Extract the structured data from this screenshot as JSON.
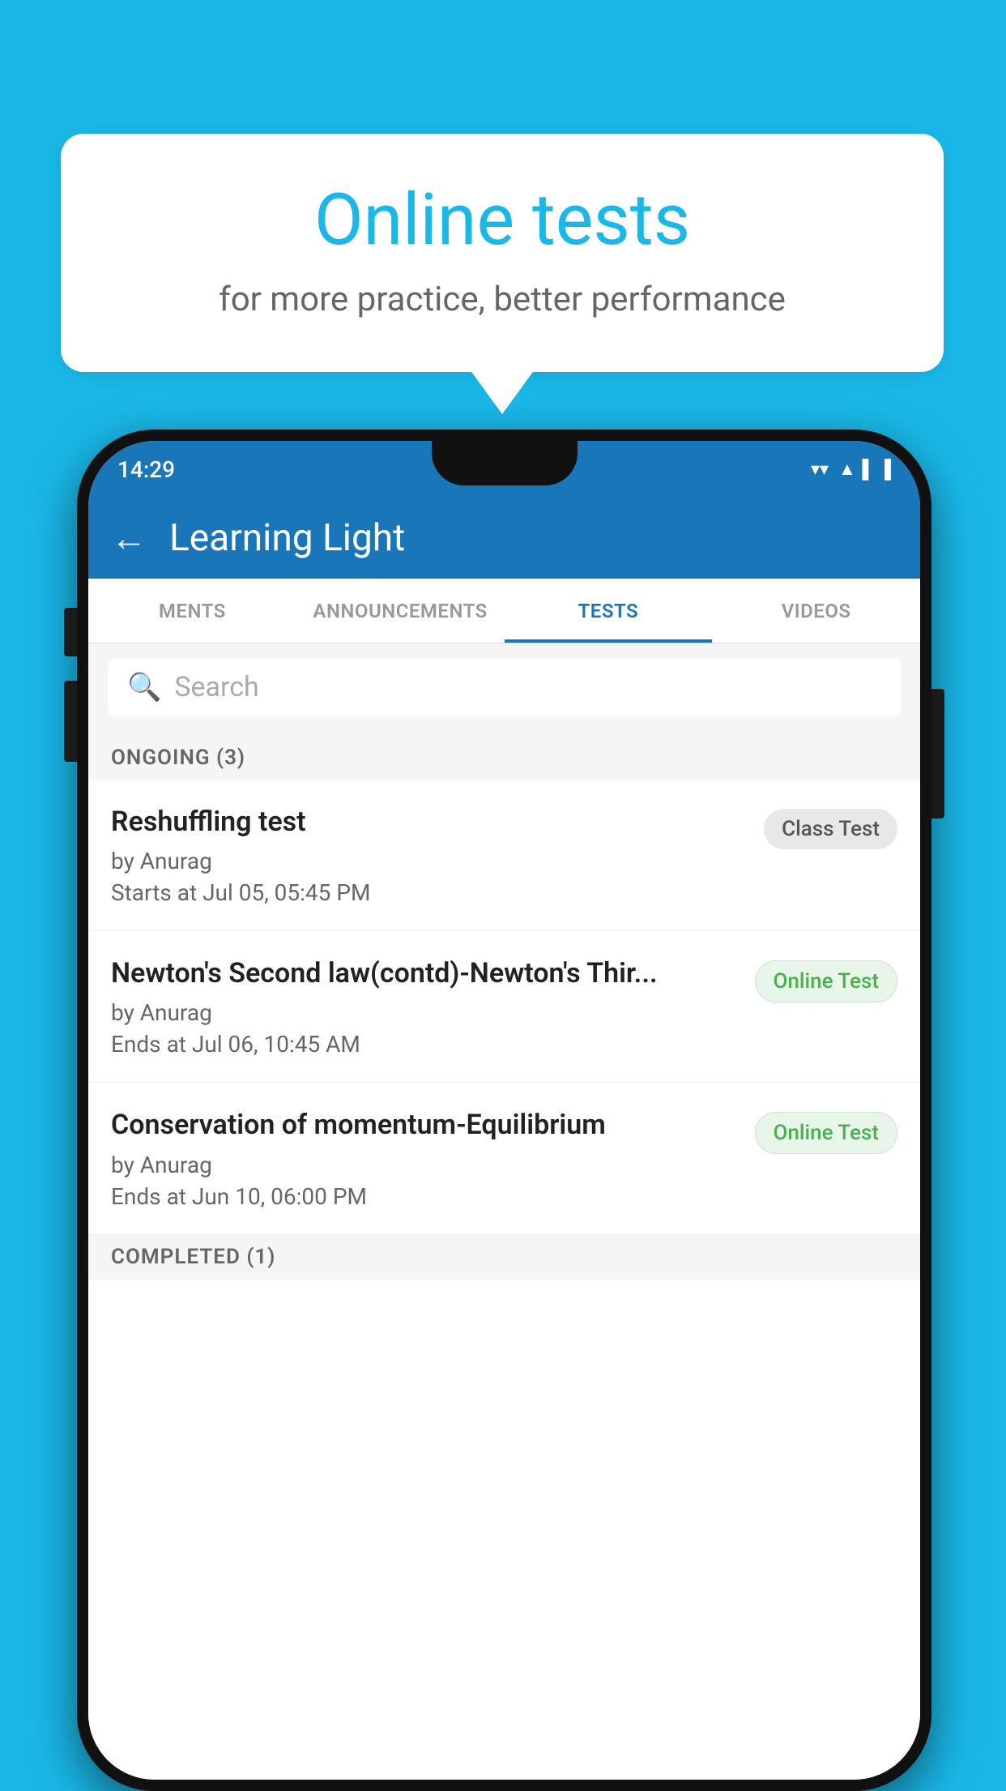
{
  "background_color": "#1ab8e8",
  "bubble": {
    "title": "Online tests",
    "subtitle": "for more practice, better performance"
  },
  "phone": {
    "status_bar": {
      "time": "14:29",
      "wifi_icon": "▼",
      "signal_icon": "▲",
      "battery_icon": "▐"
    },
    "app_bar": {
      "title": "Learning Light",
      "back_label": "←"
    },
    "tabs": [
      {
        "label": "MENTS",
        "active": false
      },
      {
        "label": "ANNOUNCEMENTS",
        "active": false
      },
      {
        "label": "TESTS",
        "active": true
      },
      {
        "label": "VIDEOS",
        "active": false
      }
    ],
    "search": {
      "placeholder": "Search"
    },
    "ongoing_section": {
      "title": "ONGOING (3)"
    },
    "tests": [
      {
        "name": "Reshuffling test",
        "by": "by Anurag",
        "date_label": "Starts at",
        "date": "Jul 05, 05:45 PM",
        "badge": "Class Test",
        "badge_type": "class"
      },
      {
        "name": "Newton's Second law(contd)-Newton's Thir...",
        "by": "by Anurag",
        "date_label": "Ends at",
        "date": "Jul 06, 10:45 AM",
        "badge": "Online Test",
        "badge_type": "online"
      },
      {
        "name": "Conservation of momentum-Equilibrium",
        "by": "by Anurag",
        "date_label": "Ends at",
        "date": "Jun 10, 06:00 PM",
        "badge": "Online Test",
        "badge_type": "online"
      }
    ],
    "completed_section": {
      "title": "COMPLETED (1)"
    }
  }
}
